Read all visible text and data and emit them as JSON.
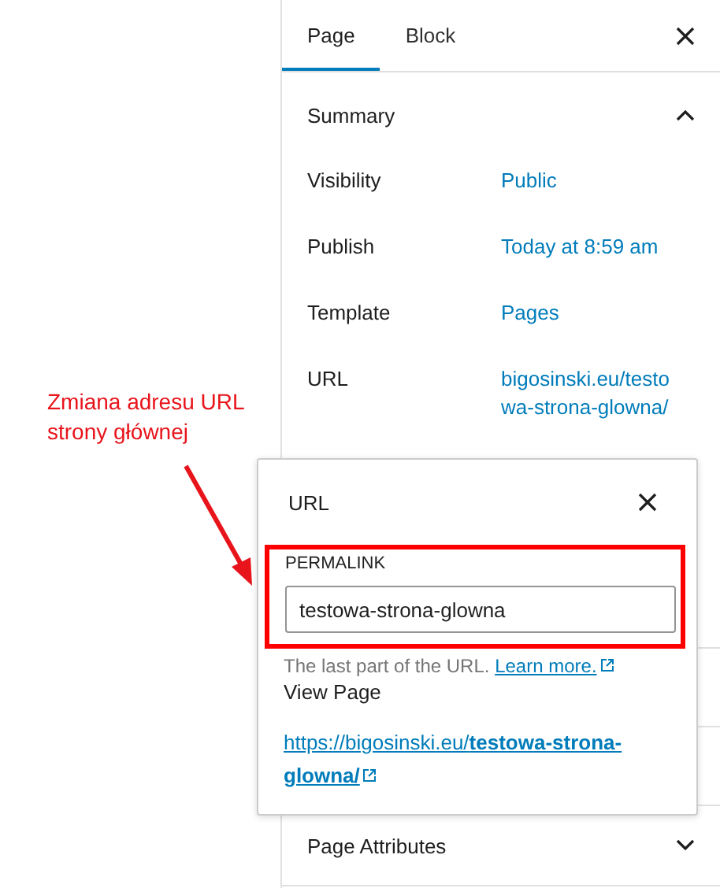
{
  "annotation": {
    "text": "Zmiana adresu URL strony głównej"
  },
  "tabs": [
    {
      "label": "Page",
      "selected": true
    },
    {
      "label": "Block",
      "selected": false
    }
  ],
  "summary": {
    "title": "Summary",
    "expanded": true,
    "rows": [
      {
        "label": "Visibility",
        "value": "Public"
      },
      {
        "label": "Publish",
        "value": "Today at 8:59 am"
      },
      {
        "label": "Template",
        "value": "Pages"
      },
      {
        "label": "URL",
        "value": "bigosinski.eu/testo wa-strona-glowna/"
      }
    ]
  },
  "page_attributes": {
    "title": "Page Attributes",
    "expanded": false
  },
  "url_popover": {
    "title": "URL",
    "field_label": "PERMALINK",
    "value": "testowa-strona-glowna",
    "help": "The last part of the URL.",
    "learn_more": "Learn more.",
    "view_label": "View Page",
    "link": "https://bigosinski.eu/",
    "link_bold": "testowa-strona-glowna/"
  }
}
